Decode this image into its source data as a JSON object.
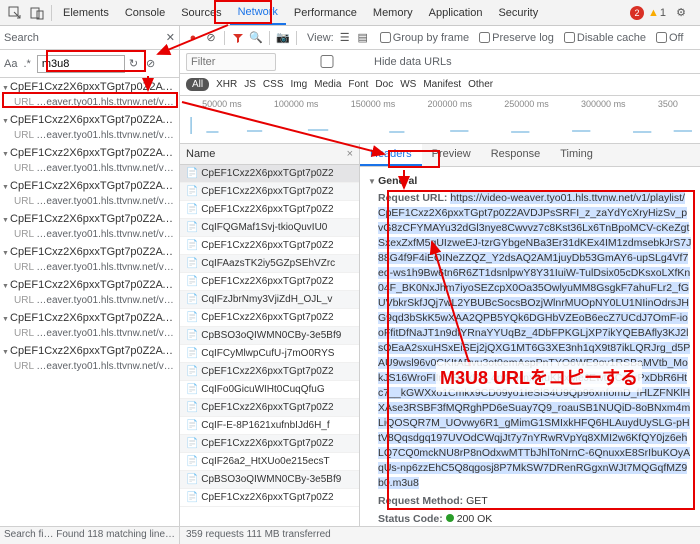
{
  "top": {
    "tabs": [
      "Elements",
      "Console",
      "Sources",
      "Network",
      "Performance",
      "Memory",
      "Application",
      "Security"
    ],
    "active": 3,
    "errors": "2",
    "warnings": "1"
  },
  "search": {
    "label": "Search",
    "aa": "Aa",
    "regex": ".*",
    "value": "m3u8",
    "refresh": "↻",
    "clear": "⊘"
  },
  "tree": {
    "file": "CpEF1Cxz2X6pxxTGpt7p0Z2AVDJP…",
    "url": "…eaver.tyo01.hls.ttvnw.net/v…",
    "url_prefix": "URL"
  },
  "tree_repeat": 9,
  "toolbar": {
    "view": "View:",
    "group": "Group by frame",
    "preserve": "Preserve log",
    "disable": "Disable cache",
    "off": "Off"
  },
  "filter": {
    "placeholder": "Filter",
    "hide": "Hide data URLs"
  },
  "types": [
    "XHR",
    "JS",
    "CSS",
    "Img",
    "Media",
    "Font",
    "Doc",
    "WS",
    "Manifest",
    "Other"
  ],
  "type_all": "All",
  "timeline": [
    "50000 ms",
    "100000 ms",
    "150000 ms",
    "200000 ms",
    "250000 ms",
    "300000 ms",
    "3500"
  ],
  "reqlist": {
    "header": "Name",
    "rows": [
      "CpEF1Cxz2X6pxxTGpt7p0Z2",
      "CpEF1Cxz2X6pxxTGpt7p0Z2",
      "CpEF1Cxz2X6pxxTGpt7p0Z2",
      "CqIFQGMaf1Svj-tkioQuvIU0",
      "CpEF1Cxz2X6pxxTGpt7p0Z2",
      "CqIFAazsTK2iy5GZpSEhVZrc",
      "CpEF1Cxz2X6pxxTGpt7p0Z2",
      "CqIFzJbrNmy3VjiZdH_OJL_v",
      "CpEF1Cxz2X6pxxTGpt7p0Z2",
      "CpBSO3oQIWMN0CBy-3e5Bf9",
      "CqIFCyMlwpCufU-j7mO0RYS",
      "CpEF1Cxz2X6pxxTGpt7p0Z2",
      "CqIFo0GicuWIHt0CuqQfuG",
      "CpEF1Cxz2X6pxxTGpt7p0Z2",
      "CqIF-E-8P1621xufnbIJd6H_f",
      "CpEF1Cxz2X6pxxTGpt7p0Z2",
      "CqIF26a2_HtXUo0e215ecsT",
      "CpBSO3oQIWMN0CBy-3e5Bf9",
      "CpEF1Cxz2X6pxxTGpt7p0Z2"
    ]
  },
  "detail": {
    "tabs": [
      "Headers",
      "Preview",
      "Response",
      "Timing"
    ],
    "active": 0,
    "general": "General",
    "request_url_k": "Request URL:",
    "request_url_v": "https://video-weaver.tyo01.hls.ttvnw.net/v1/playlist/CpEF1Cxz2X6pxxTGpt7p0Z2AVDJPsSRFI_z_zaYdYcXryHizSv_pvG8zCFYMAYu32dGl3nye8Cwvvz7c8Kst36Lx6TnBpoMCV-cKeZgtSxexZxfM5qUIzweEJ-tzrGYbgeNBa3Er31dKEx4IM1zdmsebkJrS7J88G4f9F4iEOINeZZQZ_Y2dsAQ2AM1juyDb53GmAY6-upSLg4Vf7ed-ws1h9Bw6tn6R6ZT1dsnlpwY8Y31IuiW-TulDsix05cDKsxoLXfKn04F_BK0NxJhm7iyoSEZcpX0Oa35OwlyuMM8GsgkF7ahuFLr2_fGUVbkrSkfJQj7wL2YBUBcSocsBOzjWlnrMUOpNY0LU1NIinOdrsJHG9qd3bSkK5wXAA2QPB5YQk6DGHbVZEoB6ecZ7UCdJ7OmF-iooFfitDfNaJT1n9dfYRnaYYUqBz_4DbFPKGLjXP7ikYQEBAfly3KJ2lsOEaA2sxuHSxEiSEj2jQXG1MT6G3XE3nh1qX9t87ikLQRJrg_d5PAU9wsl96v0CKItADvu3ot0emAspPnTYO6WE9ov1RSBaMVtb_MokJS16WroFIImvRXxP4_4n4HKnxBfuKKxMeJEwtQCeerPxDbR6Htc7__kGWXxo1Cmkx9CD09yo1IeSlS4U9Qp96xnfomD_fHLZFNKlHXAse3RSBF3fMQRghPD6eSuay7Q9_roauSB1NUQiD-8oBNxm4mLiQOSQR7M_UOvwy6R1_gMimG1SMIxkHFQ6HLAuydUySLG-pHtV8Qqsdgq197UVOdCWqjJt7y7nYRwRVpYq8XMI2w6KfQY0jz6ehLQ7CQ0mckNU8rP8nOdxwMTTbJhlToNrnC-6QnuxxE8SrIbuKOyAqUs-np6zzEhC5Q8qgosj8P7MkSW7DRenRGgxnWJt7MQGqfMZ9b0.m3u8",
    "request_method_k": "Request Method:",
    "request_method_v": "GET",
    "status_k": "Status Code:",
    "status_v": "200  OK"
  },
  "footer": {
    "left": "Search fi…   Found 118 matching line…",
    "right": "359 requests    111 MB transferred"
  },
  "ann": {
    "copy_label": "M3U8 URLをコピーする"
  }
}
